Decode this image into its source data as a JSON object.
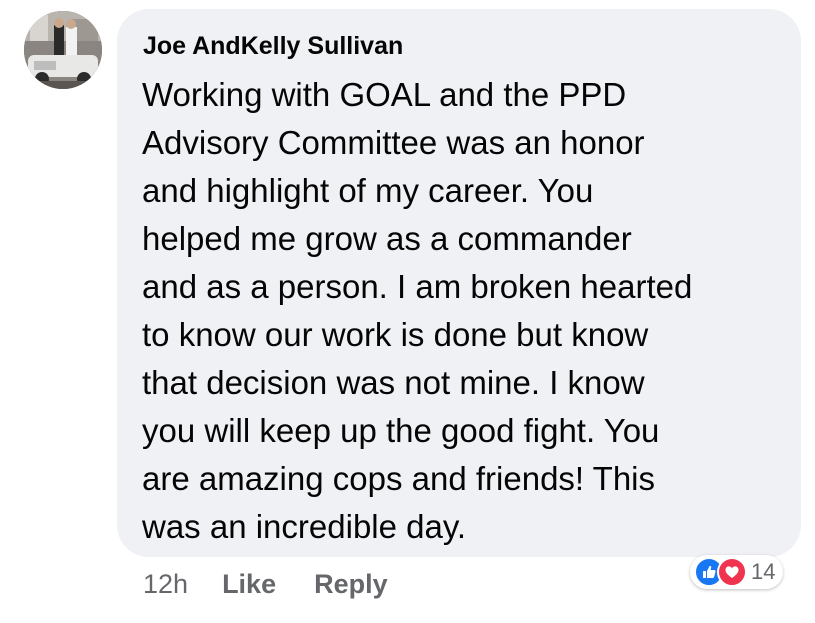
{
  "comment": {
    "author": "Joe AndKelly Sullivan",
    "text": "Working with GOAL and the PPD\nAdvisory Committee was an honor\nand highlight of my career. You\nhelped me grow as a commander\nand as a person. I am broken hearted\nto know our work is done but know\nthat decision was not mine. I know\nyou will keep up the good fight. You\nare amazing cops and friends!  This\nwas an incredible day.",
    "bubble_color": "#f0f1f5"
  },
  "actions": {
    "timestamp": "12h",
    "like_label": "Like",
    "reply_label": "Reply"
  },
  "reactions": {
    "icons": [
      "like-icon",
      "love-icon"
    ],
    "like_color": "#1877f2",
    "love_color": "#f0334f",
    "count": "14"
  }
}
